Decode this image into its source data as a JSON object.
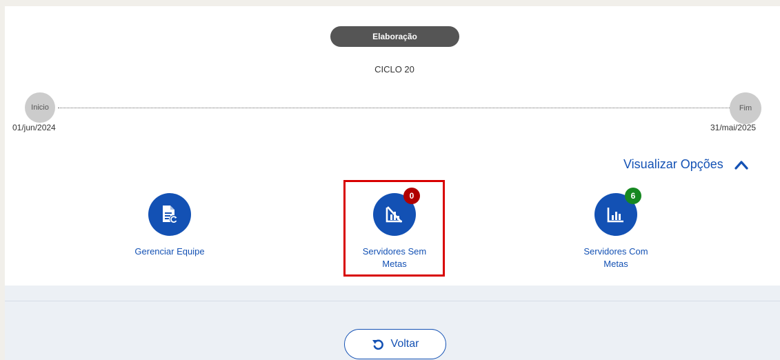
{
  "status": "Elaboração",
  "cycle": "CICLO 20",
  "timeline": {
    "start_label": "Inicio",
    "start_date": "01/jun/2024",
    "end_label": "Fim",
    "end_date": "31/mai/2025"
  },
  "view_options": {
    "label": "Visualizar Opções",
    "icon": "chevron-up-icon"
  },
  "actions": [
    {
      "label": "Gerenciar Equipe",
      "icon": "document-refresh-icon"
    },
    {
      "label_line1": "Servidores Sem",
      "label_line2": "Metas",
      "icon": "chart-off-icon",
      "badge": "0",
      "badge_color": "#b00000"
    },
    {
      "label_line1": "Servidores Com",
      "label_line2": "Metas",
      "icon": "bar-chart-icon",
      "badge": "6",
      "badge_color": "#168821"
    }
  ],
  "back_button": {
    "label": "Voltar",
    "icon": "undo-icon"
  },
  "colors": {
    "primary": "#1351b4",
    "highlight": "#d80000",
    "pill": "#555555"
  }
}
